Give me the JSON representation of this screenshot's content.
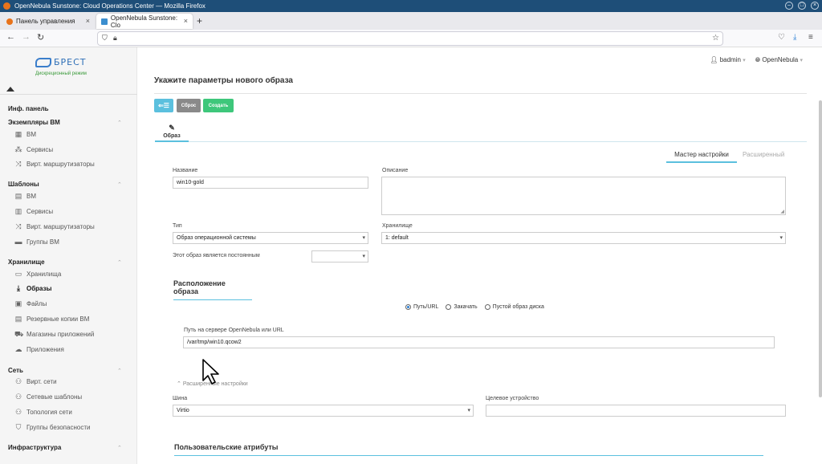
{
  "window": {
    "title": "OpenNebula Sunstone: Cloud Operations Center — Mozilla Firefox"
  },
  "browser": {
    "tabs": [
      {
        "label": "Панель управления"
      },
      {
        "label": "OpenNebula Sunstone: Clo"
      }
    ],
    "new_tab": "+"
  },
  "sidebar": {
    "logo_text": "БРЕСТ",
    "logo_sub": "Дискреционный режим",
    "sections": [
      {
        "title": "Инф. панель"
      },
      {
        "title": "Экземпляры ВМ",
        "items": [
          "ВМ",
          "Сервисы",
          "Вирт. маршрутизаторы"
        ]
      },
      {
        "title": "Шаблоны",
        "items": [
          "ВМ",
          "Сервисы",
          "Вирт. маршрутизаторы",
          "Группы ВМ"
        ]
      },
      {
        "title": "Хранилище",
        "items": [
          "Хранилища",
          "Образы",
          "Файлы",
          "Резервные копии ВМ",
          "Магазины приложений",
          "Приложения"
        ]
      },
      {
        "title": "Сеть",
        "items": [
          "Вирт. сети",
          "Сетевые шаблоны",
          "Топология сети",
          "Группы безопасности"
        ]
      },
      {
        "title": "Инфраструктура"
      }
    ]
  },
  "userbar": {
    "user": "badmin",
    "zone": "OpenNebula"
  },
  "page": {
    "title": "Укажите параметры нового образа",
    "buttons": {
      "back": "⇐☰",
      "reset": "Сброс",
      "create": "Создать"
    },
    "tab_image": "Образ",
    "modes": {
      "wizard": "Мастер настройки",
      "advanced": "Расширенный"
    }
  },
  "form": {
    "name_label": "Название",
    "name_value": "win10-gold",
    "description_label": "Описание",
    "type_label": "Тип",
    "type_value": "Образ операционной системы",
    "datastore_label": "Хранилище",
    "datastore_value": "1: default",
    "persistent_label": "Этот образ является постоянным",
    "persistent_value": "",
    "location_head": "Расположение образа",
    "radio_options": [
      {
        "label": "Путь/URL",
        "checked": true
      },
      {
        "label": "Закачать",
        "checked": false
      },
      {
        "label": "Пустой образ диска",
        "checked": false
      }
    ],
    "path_label": "Путь на сервере OpenNebula или URL",
    "path_value": "/var/tmp/win10.qcow2",
    "advanced_toggle": "Расширенные настройки",
    "bus_label": "Шина",
    "bus_value": "Virtio",
    "target_label": "Целевое устройство",
    "target_value": "",
    "custom_attrs_head": "Пользовательские атрибуты"
  },
  "colors": {
    "accent": "#5bc0de",
    "create": "#3ec77b",
    "reset": "#8a8a8a",
    "titlebar": "#1e4e78"
  }
}
